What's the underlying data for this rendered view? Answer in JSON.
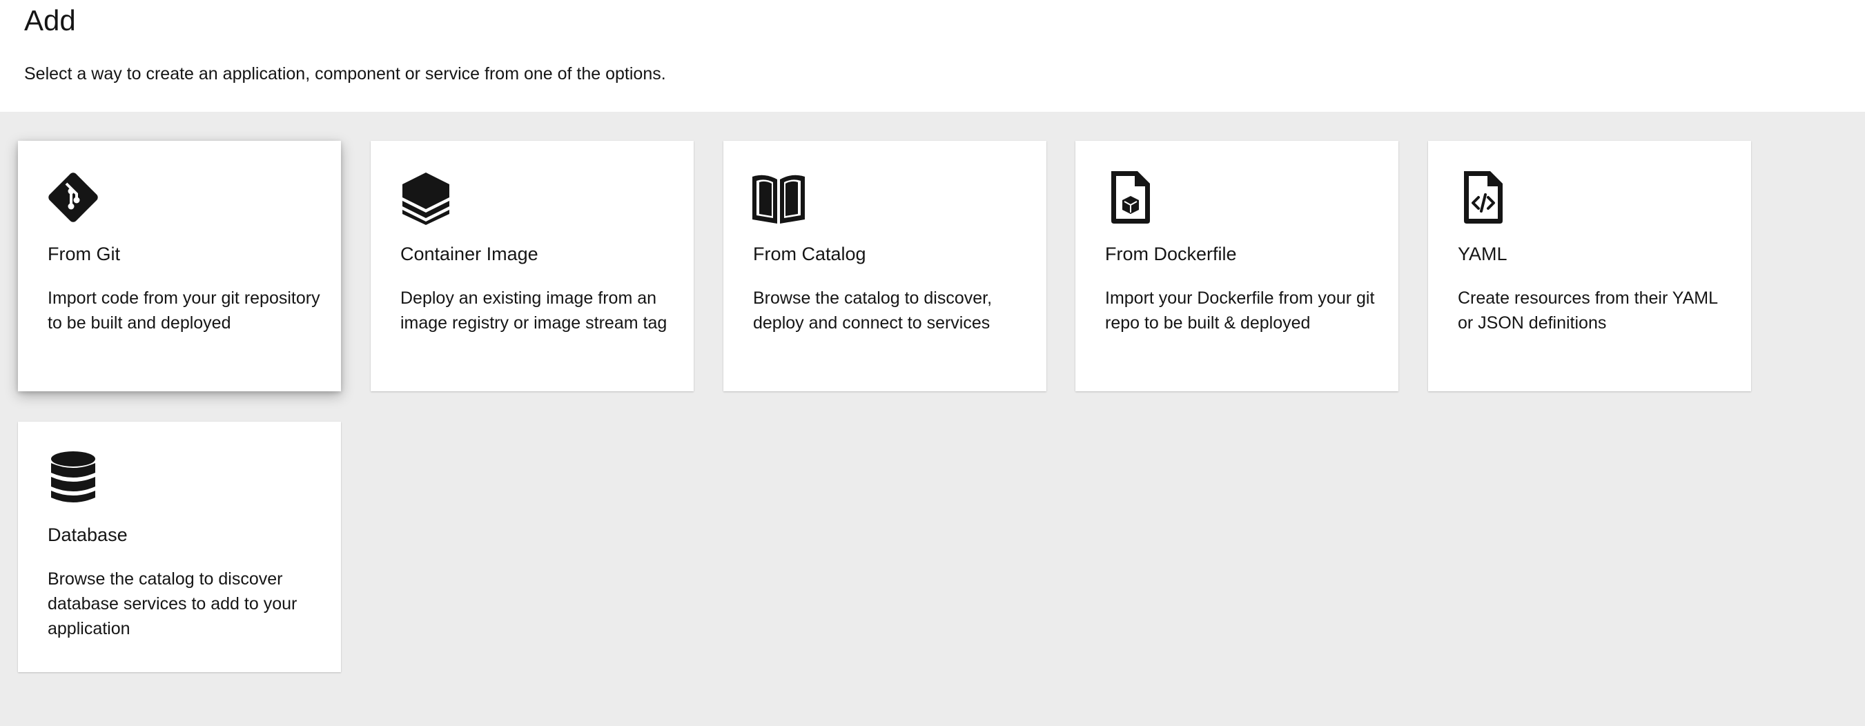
{
  "header": {
    "title": "Add",
    "subtitle": "Select a way to create an application, component or service from one of the options."
  },
  "cards": [
    {
      "title": "From Git",
      "description": "Import code from your git repository to be built and deployed",
      "icon": "git-icon"
    },
    {
      "title": "Container Image",
      "description": "Deploy an existing image from an image registry or image stream tag",
      "icon": "layers-icon"
    },
    {
      "title": "From Catalog",
      "description": "Browse the catalog to discover, deploy and connect to services",
      "icon": "book-icon"
    },
    {
      "title": "From Dockerfile",
      "description": "Import your Dockerfile from your git repo to be built & deployed",
      "icon": "dockerfile-icon"
    },
    {
      "title": "YAML",
      "description": "Create resources from their YAML or JSON definitions",
      "icon": "code-file-icon"
    },
    {
      "title": "Database",
      "description": "Browse the catalog to discover database services to add to your application",
      "icon": "database-icon"
    }
  ],
  "colors": {
    "background": "#ececec",
    "card": "#ffffff",
    "text": "#151515",
    "icon": "#151515"
  }
}
